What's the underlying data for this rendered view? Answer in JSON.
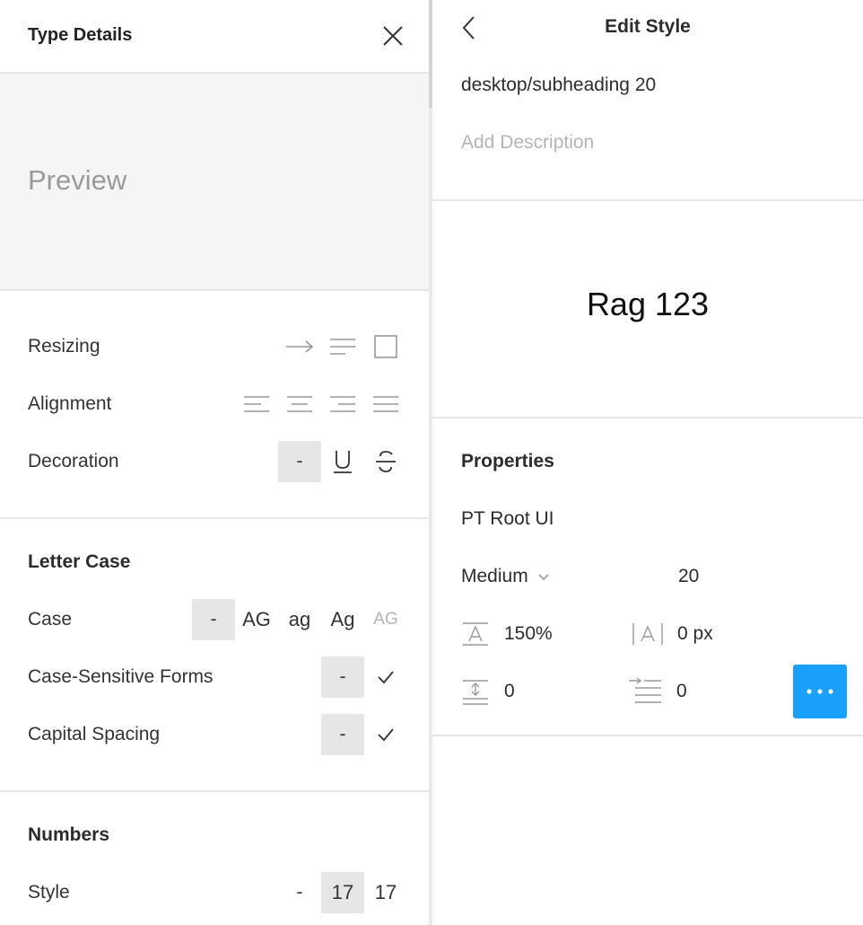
{
  "type_details": {
    "title": "Type Details",
    "preview_text": "Preview",
    "rows": {
      "resizing": "Resizing",
      "alignment": "Alignment",
      "decoration": "Decoration"
    },
    "decoration_none": "-",
    "letter_case": {
      "title": "Letter Case",
      "case_label": "Case",
      "case_options": [
        "-",
        "AG",
        "ag",
        "Ag",
        "AG"
      ],
      "case_sensitive_label": "Case-Sensitive Forms",
      "case_sensitive_none": "-",
      "capital_spacing_label": "Capital Spacing",
      "capital_spacing_none": "-"
    },
    "numbers": {
      "title": "Numbers",
      "style_label": "Style",
      "style_options": [
        "-",
        "17",
        "17"
      ]
    }
  },
  "edit_style": {
    "title": "Edit Style",
    "style_name": "desktop/subheading 20",
    "description_placeholder": "Add Description",
    "sample_text": "Rag 123",
    "properties": {
      "title": "Properties",
      "font_family": "PT Root UI",
      "font_weight": "Medium",
      "font_size": "20",
      "line_height": "150%",
      "letter_spacing": "0 px",
      "paragraph_spacing": "0",
      "paragraph_indent": "0"
    }
  },
  "colors": {
    "accent": "#18a0fb",
    "selected_bg": "#e6e6e6",
    "divider": "#e6e6e6"
  }
}
